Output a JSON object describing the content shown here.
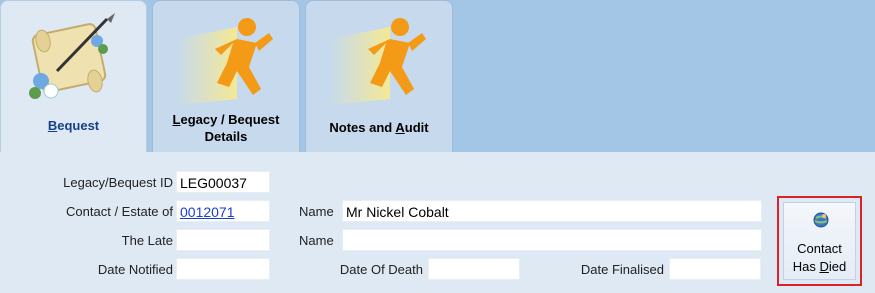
{
  "tabs": [
    {
      "name": "bequest",
      "label_pre": "",
      "label_u": "B",
      "label_post": "equest",
      "label2": "",
      "icon": "scroll-quill-icon"
    },
    {
      "name": "legacy-details",
      "label_pre": "",
      "label_u": "L",
      "label_post": "egacy / Bequest",
      "label2": "Details",
      "icon": "running-man-icon"
    },
    {
      "name": "notes-audit",
      "label_pre": "Notes and ",
      "label_u": "A",
      "label_post": "udit",
      "label2": "",
      "icon": "running-man-icon"
    }
  ],
  "form": {
    "legacy_id_label": "Legacy/Bequest ID",
    "legacy_id_value": "LEG00037",
    "contact_label": "Contact / Estate of",
    "contact_value": "0012071",
    "the_late_label": "The Late",
    "the_late_value": "",
    "date_notified_label": "Date Notified",
    "date_notified_value": "",
    "name_label": "Name",
    "name_value": "Mr Nickel Cobalt",
    "name2_label": "Name",
    "name2_value": "",
    "date_of_death_label": "Date Of Death",
    "date_of_death_value": "",
    "date_finalised_label": "Date Finalised",
    "date_finalised_value": ""
  },
  "button": {
    "line1": "Contact",
    "line2_pre": "Has ",
    "line2_u": "D",
    "line2_post": "ied",
    "icon": "globe-person-icon"
  },
  "colors": {
    "background": "#a3c6e6",
    "panel": "#dfe9f4",
    "active_tab_text": "#17408b",
    "link": "#1a3fd0",
    "highlight_border": "#d8232a"
  }
}
